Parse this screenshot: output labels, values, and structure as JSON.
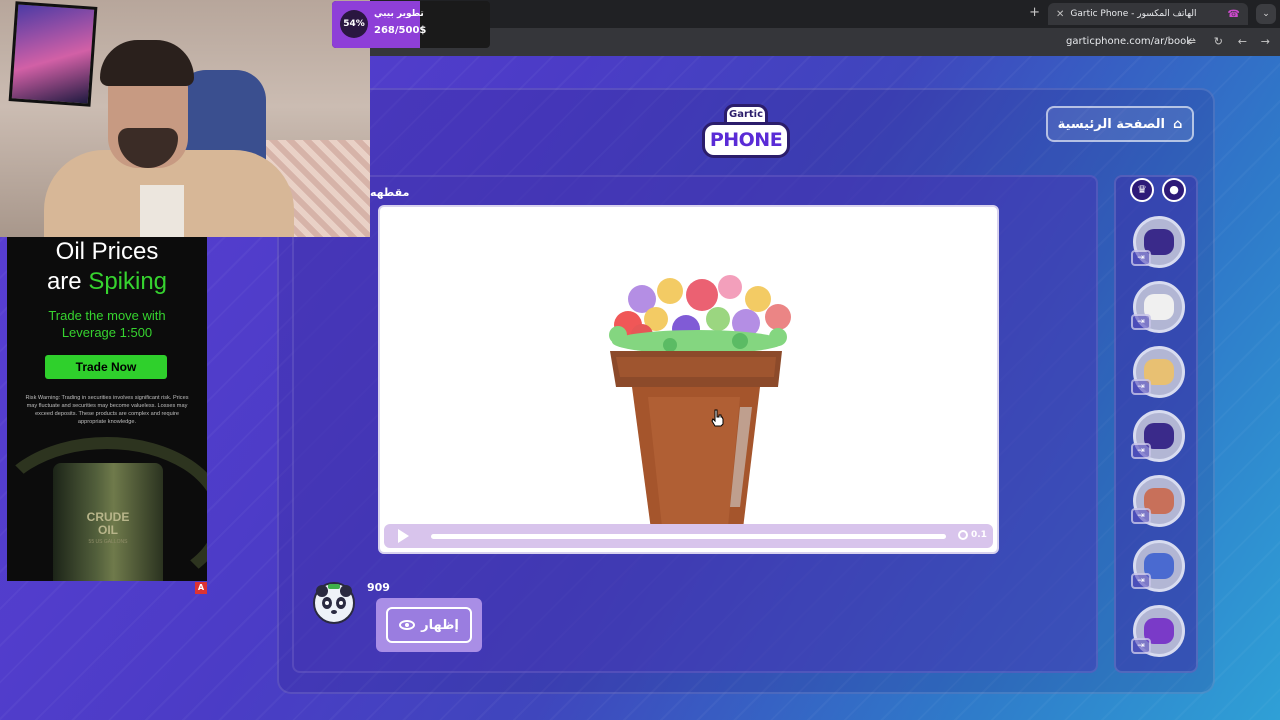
{
  "browser": {
    "tab_title": "Gartic Phone - الهاتف المكسور",
    "url": "garticphone.com/ar/book",
    "new_tab": "+",
    "close_tab": "✕"
  },
  "donation": {
    "percent": "54%",
    "label": "تطوير بيبي",
    "amount": "268/500$"
  },
  "game": {
    "logo_top": "Gartic",
    "logo_bottom": "PHONE",
    "home_button": "الصفحة الرئيسية",
    "author_label": "مقطهه",
    "drawing_time": "0.1",
    "progress": 1.0,
    "reply": {
      "name": "909",
      "show_button": "إظهار"
    },
    "players_count": 7
  },
  "ad": {
    "line1": "Oil Prices",
    "line2_prefix": "are ",
    "line2_accent": "Spiking",
    "sub1": "Trade the move with",
    "sub2": "Leverage 1:500",
    "cta": "Trade Now",
    "warning": "Risk Warning: Trading in securities involves significant risk. Prices may fluctuate and securities may become valueless. Losses may exceed deposits. These products are complex and require appropriate knowledge.",
    "barrel_line1": "CRUDE",
    "barrel_line2": "OIL",
    "barrel_small": "55 US GALLONS",
    "badge": "A"
  },
  "colors": {
    "accent_purple": "#8e3fd8",
    "ad_green": "#36d32f"
  }
}
